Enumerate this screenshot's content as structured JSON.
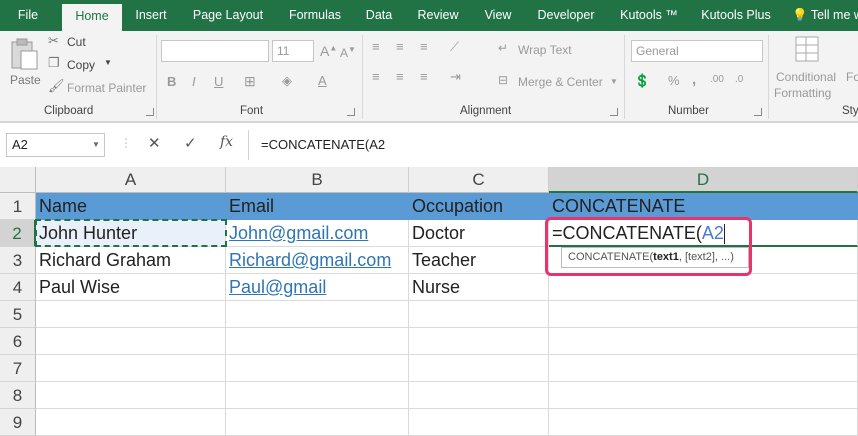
{
  "tabs": [
    "File",
    "Home",
    "Insert",
    "Page Layout",
    "Formulas",
    "Data",
    "Review",
    "View",
    "Developer",
    "Kutools ™",
    "Kutools Plus",
    "Tell me w"
  ],
  "ribbon": {
    "paste": "Paste",
    "cut": "Cut",
    "copy": "Copy",
    "format_painter": "Format Painter",
    "clipboard": "Clipboard",
    "font": "Font",
    "font_size": "11",
    "bold": "B",
    "italic": "I",
    "underline": "U",
    "wrap_text": "Wrap Text",
    "merge_center": "Merge & Center",
    "alignment": "Alignment",
    "number_format": "General",
    "number": "Number",
    "percent": "%",
    "comma": ",",
    "conditional": "Conditional",
    "formatting": "Formatting",
    "fo": "Fo",
    "sty": "Sty"
  },
  "formula_bar": {
    "name_box": "A2",
    "cancel": "✕",
    "enter": "✓",
    "fx": "fx",
    "formula": "=CONCATENATE(A2"
  },
  "columns": [
    "A",
    "B",
    "C",
    "D"
  ],
  "rows": [
    "1",
    "2",
    "3",
    "4",
    "5",
    "6",
    "7",
    "8",
    "9"
  ],
  "cells": {
    "r1": [
      "Name",
      "Email",
      "Occupation",
      "CONCATENATE"
    ],
    "r2": [
      "John Hunter",
      "John@gmail.com",
      "Doctor"
    ],
    "r3": [
      "Richard Graham",
      "Richard@gmail.com",
      "Teacher"
    ],
    "r4": [
      "Paul Wise",
      "Paul@gmail",
      "Nurse"
    ]
  },
  "edit": {
    "prefix": "=CONCATENATE(",
    "ref": "A2"
  },
  "tooltip": {
    "fn": "CONCATENATE(",
    "arg1": "text1",
    "rest": ", [text2], ...)"
  },
  "colors": {
    "excel_green": "#217346",
    "header_fill": "#5b9bd5",
    "link": "#2e75b6",
    "highlight": "#e8336b"
  }
}
